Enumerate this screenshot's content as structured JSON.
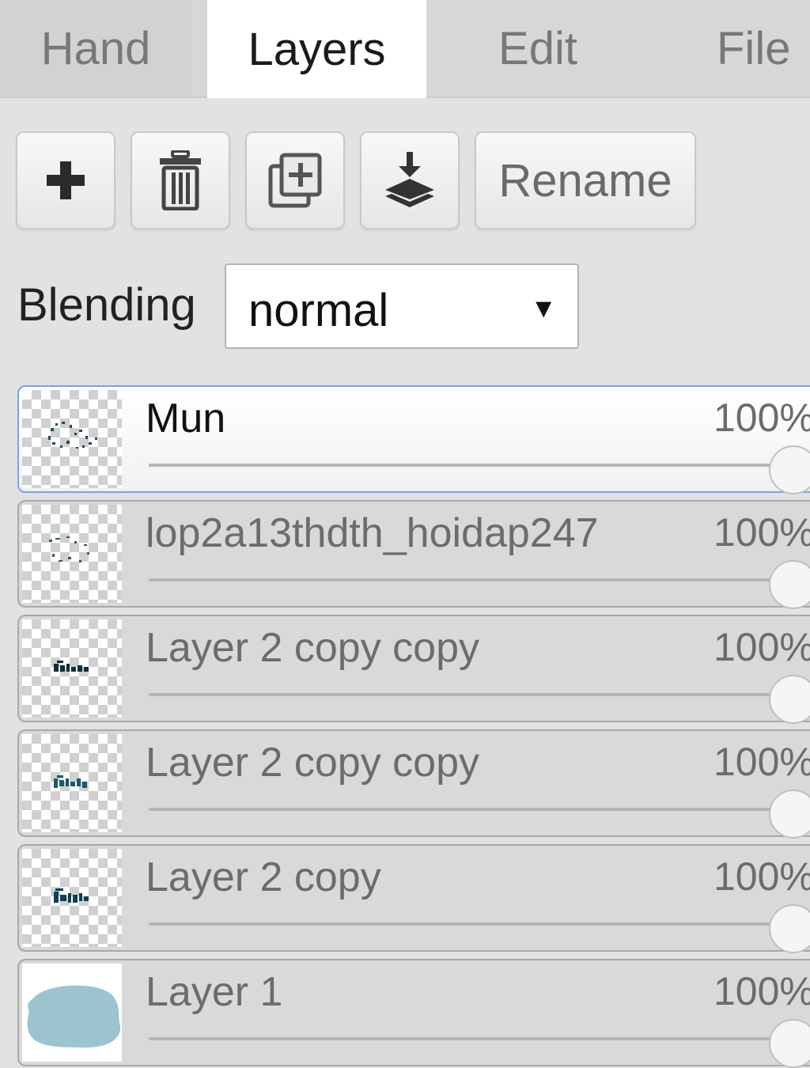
{
  "tabs": [
    {
      "label": "Hand"
    },
    {
      "label": "Layers"
    },
    {
      "label": "Edit"
    },
    {
      "label": "File"
    }
  ],
  "toolbar": {
    "add_icon": "plus-icon",
    "delete_icon": "trash-icon",
    "duplicate_icon": "duplicate-icon",
    "merge_icon": "merge-down-icon",
    "rename_label": "Rename"
  },
  "blending": {
    "label": "Blending",
    "value": "normal"
  },
  "layers": [
    {
      "name": "Mun",
      "opacity": "100%",
      "opacity_value": 100
    },
    {
      "name": "lop2a13thdth_hoidap247",
      "opacity": "100%",
      "opacity_value": 100
    },
    {
      "name": "Layer 2 copy copy",
      "opacity": "100%",
      "opacity_value": 100
    },
    {
      "name": "Layer 2 copy copy",
      "opacity": "100%",
      "opacity_value": 100
    },
    {
      "name": "Layer 2 copy",
      "opacity": "100%",
      "opacity_value": 100
    },
    {
      "name": "Layer 1",
      "opacity": "100%",
      "opacity_value": 100
    }
  ],
  "colors": {
    "selected_border": "#7da3e3",
    "layer1_fill": "#9cc4d0"
  }
}
